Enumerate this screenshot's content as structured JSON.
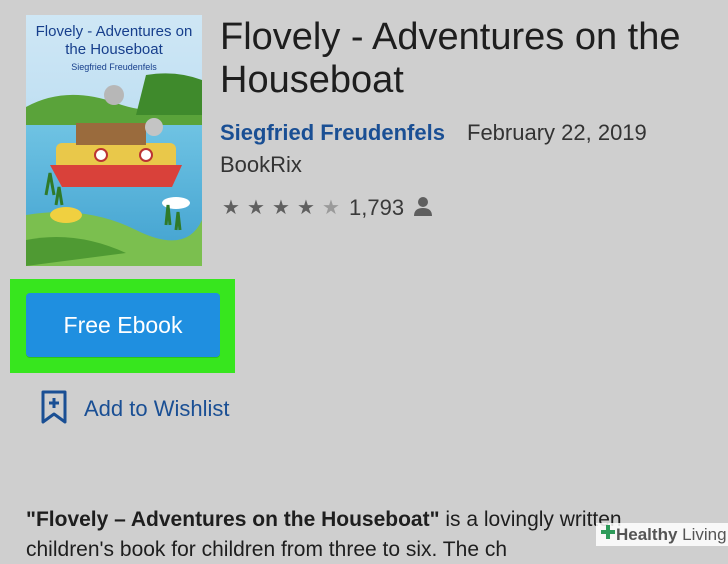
{
  "book": {
    "cover_title": "Flovely - Adventures on the Houseboat",
    "cover_author": "Siegfried Freudenfels",
    "title": "Flovely - Adventures on the Houseboat",
    "author": "Siegfried Freudenfels",
    "date": "February 22, 2019",
    "publisher": "BookRix",
    "rating_stars": 4.5,
    "rating_count": "1,793"
  },
  "actions": {
    "free_ebook_label": "Free Ebook",
    "wishlist_label": "Add to Wishlist"
  },
  "description": {
    "bold_part": "\"Flovely – Adventures on the Houseboat\"",
    "rest_line1": " is a lovingly written",
    "line2": "children's book for children from three to six. The ch"
  },
  "watermark": {
    "brand_bold": "Healthy",
    "brand_thin": " Living"
  },
  "colors": {
    "background": "#cfcfcf",
    "accent_blue": "#1f8fe0",
    "author_blue": "#1a4f94",
    "highlight_green": "#37e61e"
  },
  "icons": [
    "star-icon",
    "person-icon",
    "bookmark-plus-icon",
    "plus-icon"
  ]
}
